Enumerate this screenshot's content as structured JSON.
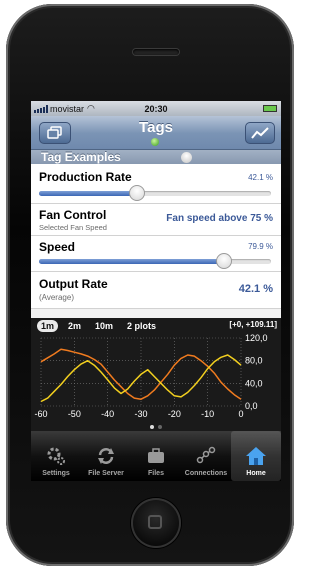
{
  "status_bar": {
    "carrier": "movistar",
    "time": "20:30"
  },
  "nav": {
    "title": "Tags"
  },
  "section": {
    "header": "Tag Examples"
  },
  "rows": {
    "production": {
      "title": "Production Rate",
      "value": "42.1 %",
      "slider_fraction": 0.421
    },
    "fan": {
      "title": "Fan Control",
      "subtitle": "Selected Fan Speed",
      "value_prefix": "Fan speed above ",
      "value_strong": "75 %"
    },
    "speed": {
      "title": "Speed",
      "value": "79.9 %",
      "slider_fraction": 0.799
    },
    "output": {
      "title": "Output Rate",
      "subtitle": "(Average)",
      "value": "42.1 %"
    }
  },
  "chart": {
    "tabs": [
      "1m",
      "2m",
      "10m",
      "2 plots"
    ],
    "active_tab": "1m",
    "range_label": "[+0, +109.11]"
  },
  "tabbar": {
    "items": [
      {
        "label": "Settings",
        "icon": "gear-icon"
      },
      {
        "label": "File Server",
        "icon": "sync-icon"
      },
      {
        "label": "Files",
        "icon": "briefcase-icon"
      },
      {
        "label": "Connections",
        "icon": "connections-icon"
      },
      {
        "label": "Home",
        "icon": "home-icon"
      }
    ],
    "active": "Home"
  },
  "colors": {
    "nav_blue": "#7b94b5",
    "value_blue": "#3b5998",
    "series_orange": "#f07b1f",
    "series_yellow": "#f2cf1f",
    "grid": "#777777"
  },
  "chart_data": {
    "type": "line",
    "xlim": [
      -60,
      0
    ],
    "ylim": [
      0,
      120
    ],
    "x_ticks": [
      "-60",
      "-50",
      "-40",
      "-30",
      "-20",
      "-10",
      "0"
    ],
    "y_ticks": [
      "0,0",
      "40,0",
      "80,0",
      "120,0"
    ],
    "grid": true,
    "series": [
      {
        "color": "#f07b1f",
        "x": [
          -60,
          -58,
          -56,
          -54,
          -52,
          -50,
          -48,
          -46,
          -44,
          -42,
          -40,
          -38,
          -36,
          -34,
          -32,
          -30,
          -28,
          -26,
          -24,
          -22,
          -20,
          -18,
          -16,
          -14,
          -12,
          -10,
          -8,
          -6,
          -4,
          -2,
          0
        ],
        "values": [
          78,
          85,
          92,
          100,
          98,
          95,
          92,
          88,
          82,
          74,
          60,
          46,
          34,
          22,
          14,
          12,
          18,
          28,
          42,
          56,
          72,
          84,
          90,
          88,
          80,
          70,
          58,
          42,
          30,
          20,
          12
        ]
      },
      {
        "color": "#f2cf1f",
        "x": [
          -60,
          -58,
          -56,
          -54,
          -52,
          -50,
          -48,
          -46,
          -44,
          -42,
          -40,
          -38,
          -36,
          -34,
          -32,
          -30,
          -28,
          -26,
          -24,
          -22,
          -20,
          -18,
          -16,
          -14,
          -12,
          -10,
          -8,
          -6,
          -4,
          -2,
          0
        ],
        "values": [
          8,
          14,
          26,
          38,
          52,
          64,
          74,
          80,
          72,
          60,
          46,
          32,
          22,
          30,
          44,
          56,
          64,
          52,
          40,
          28,
          18,
          16,
          24,
          36,
          50,
          66,
          78,
          86,
          90,
          82,
          72
        ]
      }
    ]
  }
}
